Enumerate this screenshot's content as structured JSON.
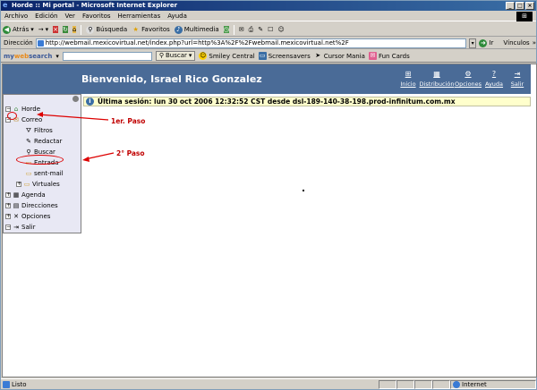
{
  "window": {
    "title": "Horde :: Mi portal - Microsoft Internet Explorer",
    "controls": [
      "_",
      "□",
      "×"
    ]
  },
  "menu": [
    "Archivo",
    "Edición",
    "Ver",
    "Favoritos",
    "Herramientas",
    "Ayuda"
  ],
  "toolbar": {
    "back": "Atrás",
    "search": "Búsqueda",
    "favorites": "Favoritos",
    "multimedia": "Multimedia"
  },
  "address": {
    "label": "Dirección",
    "url": "http://webmail.mexicovirtual.net/index.php?url=http%3A%2F%2Fwebmail.mexicovirtual.net%2F",
    "go": "Ir",
    "links": "Vínculos"
  },
  "searchbar": {
    "brand_pre": "my",
    "brand_mid": "web",
    "brand_post": "search",
    "search_button": "Buscar",
    "items": [
      "Smiley Central",
      "Screensavers",
      "Cursor Mania",
      "Fun Cards"
    ]
  },
  "horde": {
    "welcome": "Bienvenido, Israel Rico Gonzalez",
    "nav": [
      "Inicio",
      "Distribución",
      "Opciones",
      "Ayuda",
      "Salir"
    ],
    "last_session": "Última sesión: lun 30 oct 2006 12:32:52 CST desde dsl-189-140-38-198.prod-infinitum.com.mx"
  },
  "sidebar": {
    "items": [
      {
        "label": "Horde",
        "icon": "house-icon"
      },
      {
        "label": "Correo",
        "icon": "envelope-icon"
      },
      {
        "label": "Filtros",
        "icon": "filter-icon"
      },
      {
        "label": "Redactar",
        "icon": "compose-icon"
      },
      {
        "label": "Buscar",
        "icon": "magnifier-icon"
      },
      {
        "label": "Entrada",
        "icon": "inbox-folder-icon"
      },
      {
        "label": "sent-mail",
        "icon": "folder-icon"
      },
      {
        "label": "Virtuales",
        "icon": "folder-icon"
      },
      {
        "label": "Agenda",
        "icon": "calendar-icon"
      },
      {
        "label": "Direcciones",
        "icon": "address-book-icon"
      },
      {
        "label": "Opciones",
        "icon": "tools-icon"
      },
      {
        "label": "Salir",
        "icon": "logout-icon"
      }
    ]
  },
  "annotations": {
    "step1": "1er. Paso",
    "step2": "2° Paso"
  },
  "status": {
    "text": "Listo",
    "zone": "Internet"
  }
}
